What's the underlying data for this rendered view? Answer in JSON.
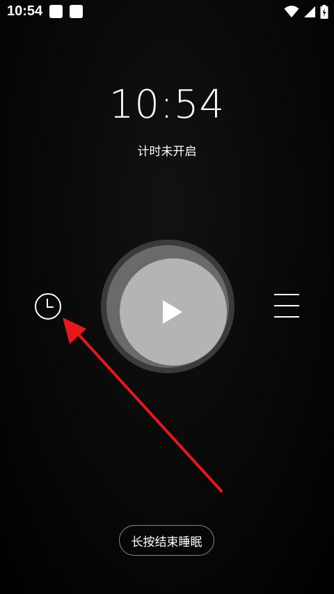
{
  "status_bar": {
    "time": "10:54",
    "notifications": [
      "notification-icon",
      "notification-icon"
    ],
    "icons": [
      "wifi-icon",
      "signal-icon",
      "battery-charging-icon"
    ]
  },
  "clock": {
    "time": "10:54",
    "timer_status": "计时未开启"
  },
  "controls": {
    "left_icon": "clock-icon",
    "center_icon": "play-icon",
    "right_icon": "menu-icon"
  },
  "annotation": {
    "arrow_color": "#e8171c"
  },
  "footer": {
    "end_sleep_label": "长按结束睡眠"
  },
  "colors": {
    "background": "#000000",
    "play_outer": "#3b3b3b",
    "play_mid": "#6a6a6a",
    "play_inner": "#b4b4b4"
  }
}
